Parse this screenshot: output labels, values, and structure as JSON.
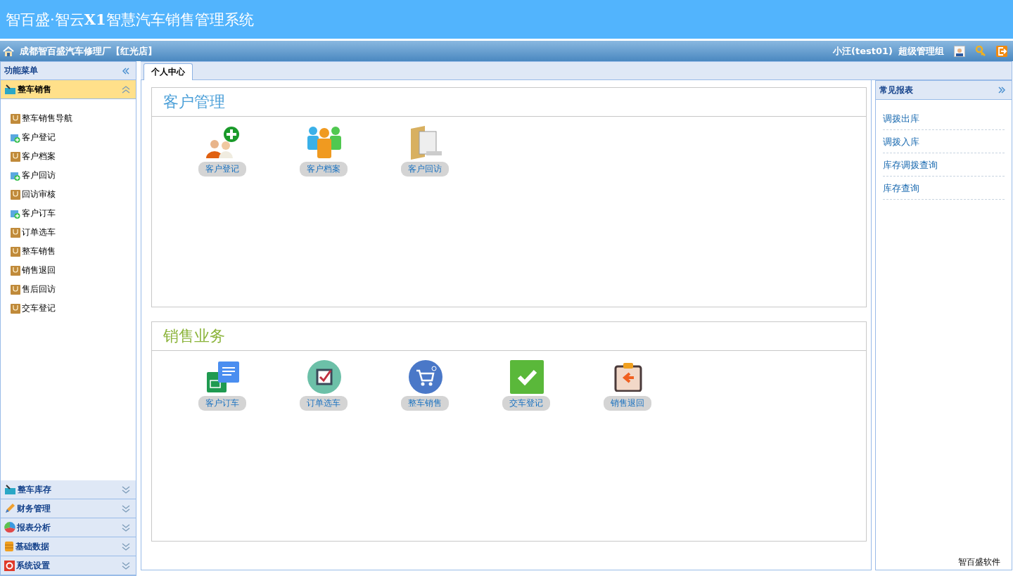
{
  "header": {
    "title": "智百盛·智云**X1**智慧汽车销售管理系统"
  },
  "topbar": {
    "store": "成都智百盛汽车修理厂【红光店】",
    "user": "小汪(test01)",
    "role": "超级管理组"
  },
  "sidebar": {
    "title": "功能菜单",
    "groups": [
      {
        "label": "整车销售",
        "kind": "car",
        "expanded": true,
        "items": [
          {
            "label": "整车销售导航",
            "kind": "bag"
          },
          {
            "label": "客户登记",
            "kind": "add"
          },
          {
            "label": "客户档案",
            "kind": "bag"
          },
          {
            "label": "客户回访",
            "kind": "add"
          },
          {
            "label": "回访审核",
            "kind": "bag"
          },
          {
            "label": "客户订车",
            "kind": "add"
          },
          {
            "label": "订单选车",
            "kind": "bag"
          },
          {
            "label": "整车销售",
            "kind": "bag"
          },
          {
            "label": "销售退回",
            "kind": "bag"
          },
          {
            "label": "售后回访",
            "kind": "bag"
          },
          {
            "label": "交车登记",
            "kind": "bag"
          }
        ]
      },
      {
        "label": "整车库存",
        "kind": "car",
        "expanded": false
      },
      {
        "label": "财务管理",
        "kind": "pencil",
        "expanded": false
      },
      {
        "label": "报表分析",
        "kind": "pie",
        "expanded": false
      },
      {
        "label": "基础数据",
        "kind": "database",
        "expanded": false
      },
      {
        "label": "系统设置",
        "kind": "gear",
        "expanded": false
      }
    ]
  },
  "tabs": [
    {
      "label": "个人中心",
      "selected": true
    }
  ],
  "panels": [
    {
      "title": "客户管理",
      "color": "#4a9fd8",
      "shortcuts": [
        {
          "label": "客户登记",
          "kind": "person-add"
        },
        {
          "label": "客户档案",
          "kind": "people"
        },
        {
          "label": "客户回访",
          "kind": "folder"
        }
      ]
    },
    {
      "title": "销售业务",
      "color": "#8cb43c",
      "shortcuts": [
        {
          "label": "客户订车",
          "kind": "documents"
        },
        {
          "label": "订单选车",
          "kind": "checkbox"
        },
        {
          "label": "整车销售",
          "kind": "cart"
        },
        {
          "label": "交车登记",
          "kind": "check"
        },
        {
          "label": "销售退回",
          "kind": "clipboard"
        }
      ]
    }
  ],
  "reports": {
    "title": "常见报表",
    "links": [
      "调拨出库",
      "调拨入库",
      "库存调拨查询",
      "库存查询"
    ]
  },
  "footer": "智百盛软件"
}
